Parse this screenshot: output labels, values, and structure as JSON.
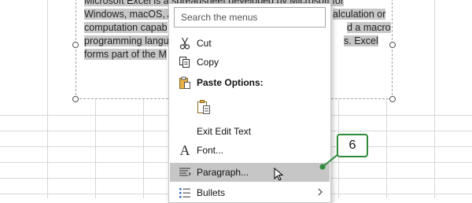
{
  "document": {
    "text_lines": [
      "Microsoft Excel is a spreadsheet developed by Microsoft for",
      "Windows, macOS, A",
      "computation capab",
      "programming langu",
      "forms part of the M"
    ],
    "text_right_fragments": [
      "alculation or",
      "d a macro",
      "s. Excel"
    ]
  },
  "context_menu": {
    "search_placeholder": "Search the menus",
    "items": {
      "cut": {
        "label": "Cut",
        "icon": "scissors-icon"
      },
      "copy": {
        "label": "Copy",
        "icon": "copy-icon"
      },
      "paste_options": {
        "label": "Paste Options:",
        "icon": "paste-icon"
      },
      "paste_keep_text": {
        "icon": "paste-keep-text-only-icon"
      },
      "exit_edit_text": {
        "label": "Exit Edit Text"
      },
      "font": {
        "label": "Font...",
        "icon": "font-icon"
      },
      "paragraph": {
        "label": "Paragraph...",
        "icon": "paragraph-icon"
      },
      "bullets": {
        "label": "Bullets",
        "icon": "bullets-icon",
        "submenu_icon": "chevron-right-icon"
      }
    }
  },
  "callout": {
    "number": "6",
    "color": "#2e8b3a"
  },
  "colors": {
    "selection": "#c7c7c7",
    "hover": "#c6c6c6",
    "callout_border": "#2e8b3a"
  }
}
